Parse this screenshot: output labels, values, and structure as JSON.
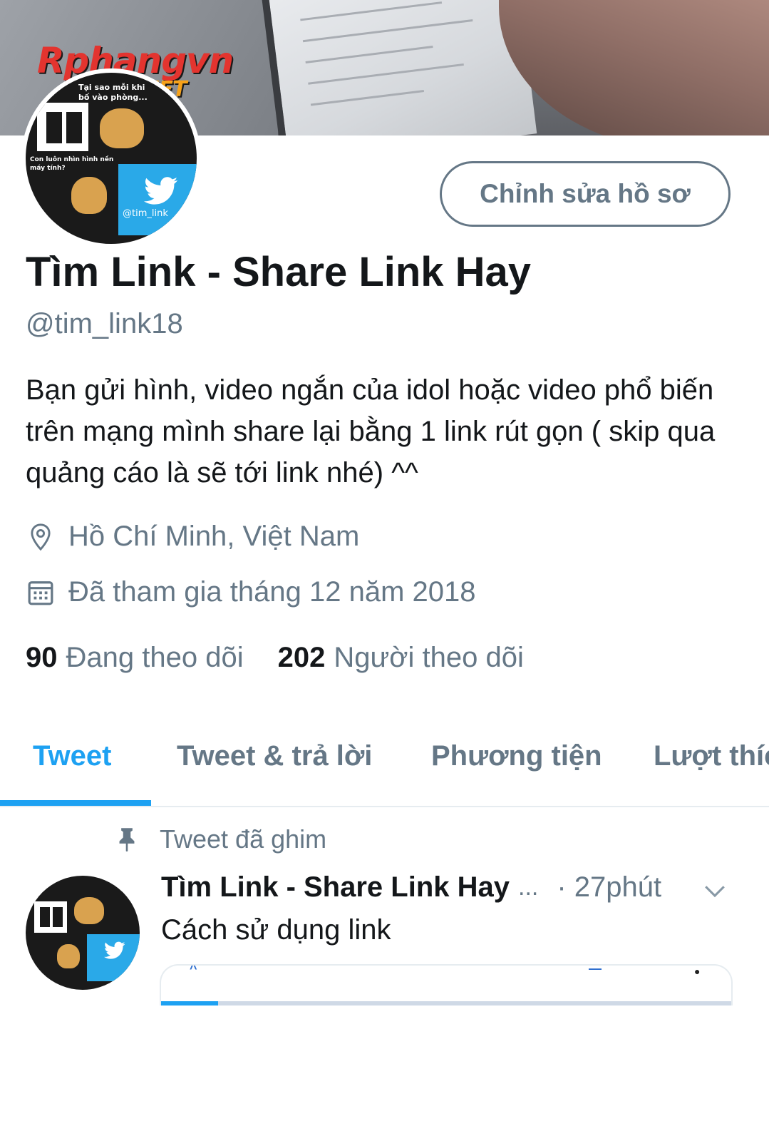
{
  "banner": {
    "watermark_main": "Rphangvn",
    "watermark_suffix": ".NET"
  },
  "avatar": {
    "caption_top": "Tại sao mỗi khi bố vào phòng...",
    "caption_mid": "Con luôn nhìn hình nền máy tính?",
    "handle_text": "@tim_link"
  },
  "profile": {
    "edit_button": "Chỉnh sửa hồ sơ",
    "name": "Tìm Link - Share Link Hay",
    "handle": "@tim_link18",
    "bio": "Bạn gửi hình, video ngắn của idol hoặc video phổ biến trên mạng mình share lại bằng 1 link rút gọn ( skip qua quảng cáo là sẽ tới link nhé) ^^",
    "location": "Hồ Chí Minh, Việt Nam",
    "joined": "Đã tham gia tháng 12 năm 2018",
    "location_icon": "location-pin-icon",
    "calendar_icon": "calendar-icon"
  },
  "stats": {
    "following_count": "90",
    "following_label": "Đang theo dõi",
    "followers_count": "202",
    "followers_label": "Người theo dõi"
  },
  "tabs": [
    {
      "label": "Tweet",
      "active": true
    },
    {
      "label": "Tweet & trả lời",
      "active": false
    },
    {
      "label": "Phương tiện",
      "active": false
    },
    {
      "label": "Lượt thích",
      "active": false
    }
  ],
  "pinned_tweet": {
    "pinned_label": "Tweet đã ghim",
    "author": "Tìm Link - Share Link Hay",
    "ellipsis": "...",
    "time": "· 27phút",
    "text": "Cách sử dụng link",
    "media_progress": 0.1
  },
  "colors": {
    "accent": "#1da1f2",
    "secondary_text": "#657786",
    "primary_text": "#14171a"
  }
}
